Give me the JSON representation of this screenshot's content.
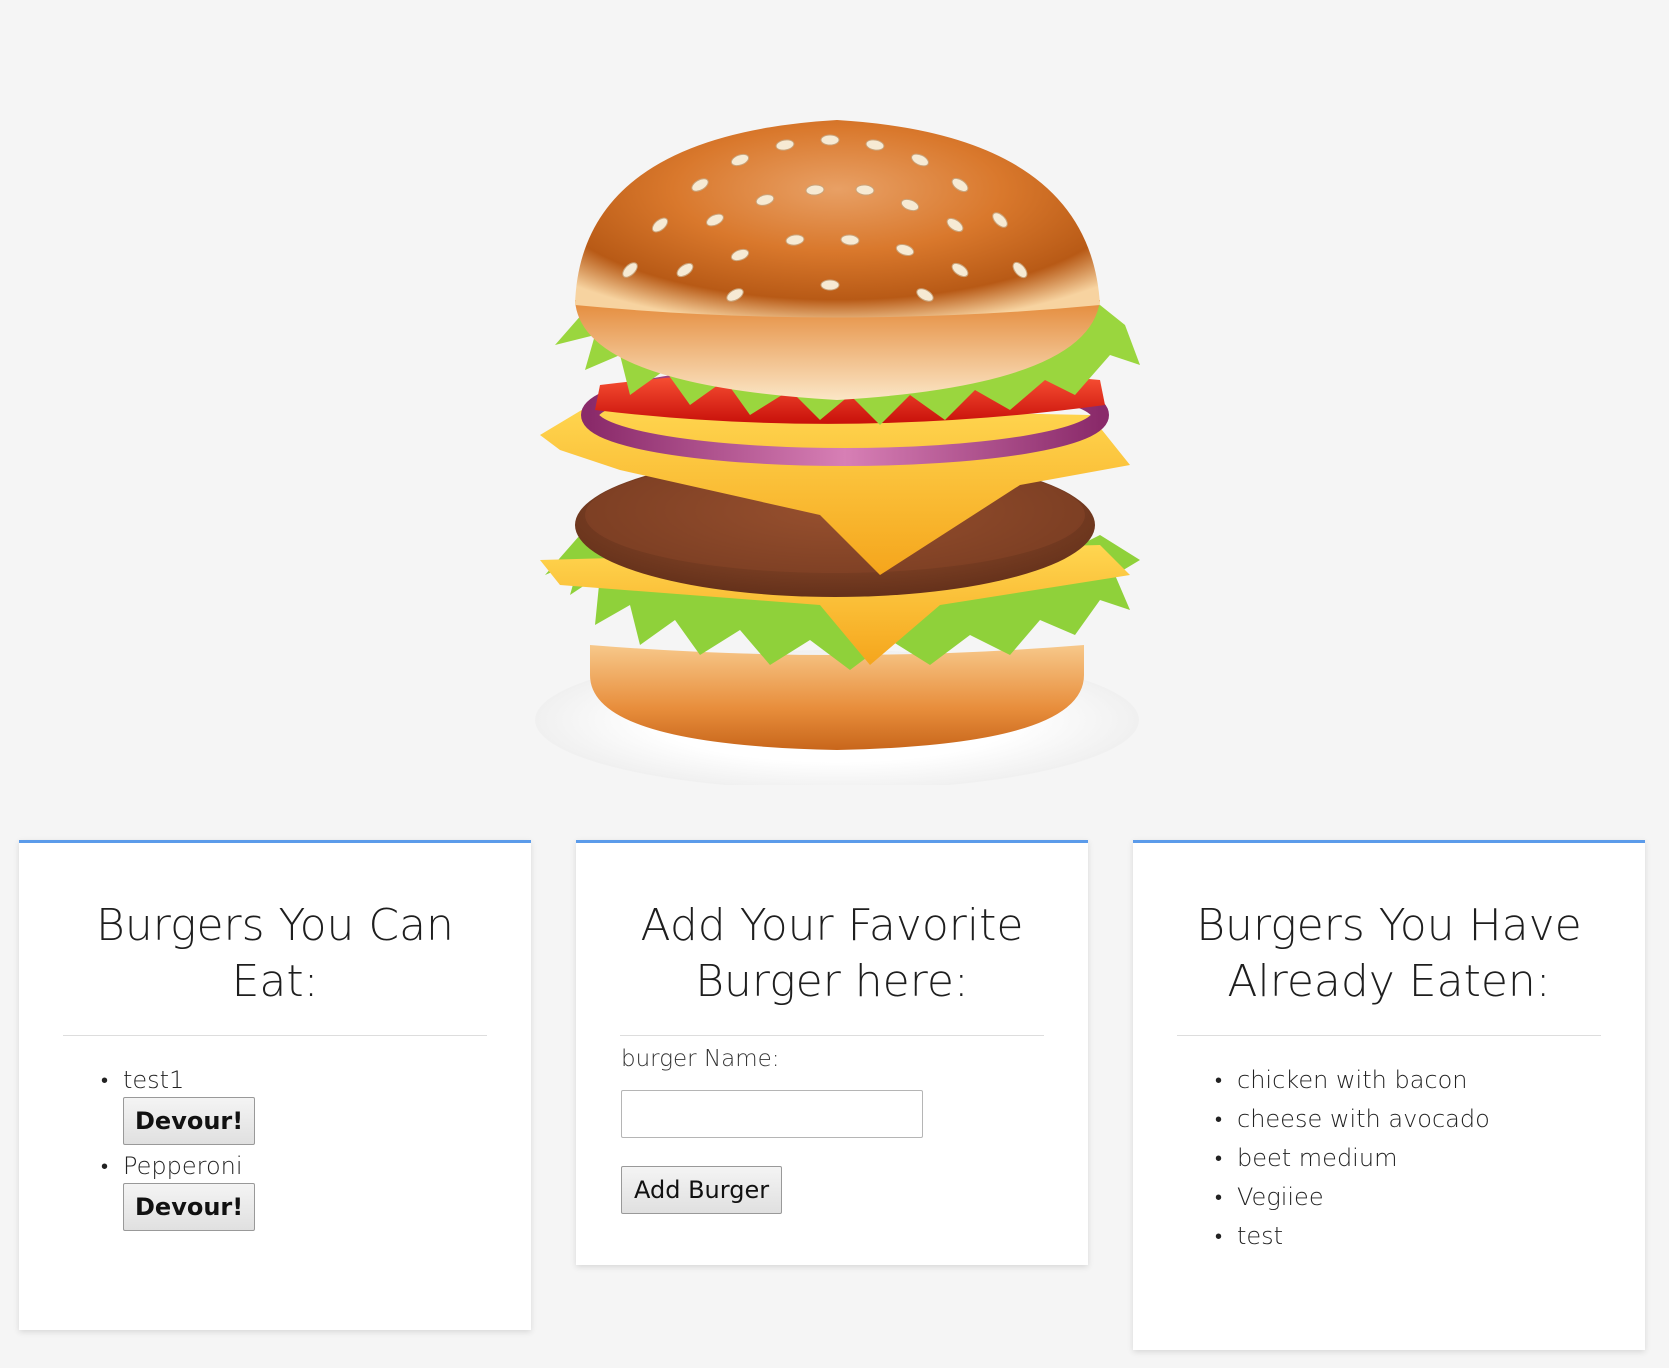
{
  "hero": {
    "image": "burger-illustration"
  },
  "left_panel": {
    "title": "Burgers You Can Eat:",
    "items": [
      {
        "name": "test1",
        "button": "Devour!"
      },
      {
        "name": "Pepperoni",
        "button": "Devour!"
      }
    ]
  },
  "middle_panel": {
    "title": "Add Your Favorite Burger here:",
    "label": "burger Name:",
    "input_value": "",
    "button": "Add Burger"
  },
  "right_panel": {
    "title": "Burgers You Have Already Eaten:",
    "items": [
      {
        "name": "chicken with bacon"
      },
      {
        "name": "cheese with avocado"
      },
      {
        "name": "beet medium"
      },
      {
        "name": "Vegiiee"
      },
      {
        "name": "test"
      }
    ]
  },
  "colors": {
    "accent": "#5b9bea",
    "background": "#f5f5f5",
    "panel": "#ffffff"
  }
}
